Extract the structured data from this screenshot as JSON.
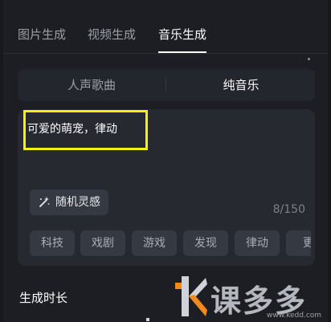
{
  "tabs": {
    "image_gen": "图片生成",
    "video_gen": "视频生成",
    "music_gen": "音乐生成"
  },
  "mode": {
    "vocal": "人声歌曲",
    "instrumental": "纯音乐"
  },
  "prompt": {
    "text": "可爱的萌宠，律动",
    "inspire_label": "随机灵感",
    "counter": "8/150"
  },
  "tags": [
    "科技",
    "戏剧",
    "游戏",
    "发现",
    "律动",
    "更"
  ],
  "duration": {
    "label": "生成时长"
  },
  "watermark": {
    "text": "课多多",
    "url": "www.kedd.com"
  },
  "colors": {
    "background": "#1c1e23",
    "card": "#262930",
    "chip": "#353942",
    "active_text": "#ffffff",
    "inactive_text": "#9a9ea6",
    "highlight_box": "#f2f20e",
    "logo_orange": "#f08a1c"
  },
  "icons": {
    "inspire": "magic-wand-icon"
  }
}
